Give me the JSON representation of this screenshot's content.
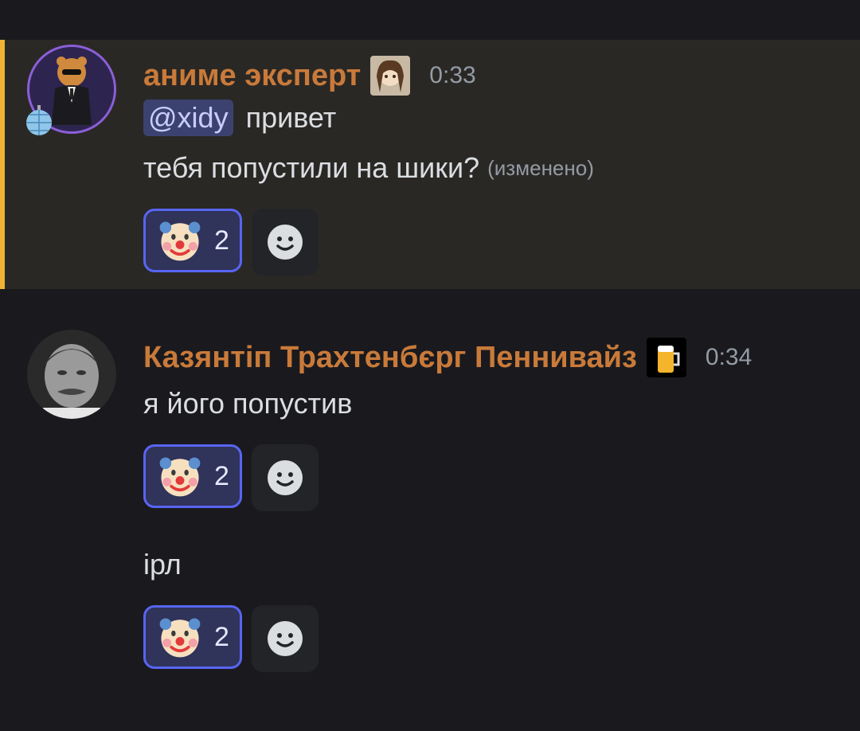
{
  "messages": [
    {
      "author": "аниме эксперт",
      "author_color": "#c97a3a",
      "timestamp": "0:33",
      "lines": [
        {
          "mention": "@xidy",
          "text": "привет"
        },
        {
          "text": "тебя попустили на шики?",
          "edited_label": "(изменено)"
        }
      ],
      "reactions": [
        {
          "emoji": "clown-face",
          "count": "2"
        }
      ]
    },
    {
      "author": "Казянтiп Трахтенбєрг Пеннивайз",
      "author_color": "#c97a3a",
      "timestamp": "0:34",
      "lines": [
        {
          "text": "я його попустив"
        }
      ],
      "reactions": [
        {
          "emoji": "clown-face",
          "count": "2"
        }
      ]
    },
    {
      "lines": [
        {
          "text": "iрл"
        }
      ],
      "reactions": [
        {
          "emoji": "clown-face",
          "count": "2"
        }
      ]
    }
  ],
  "colors": {
    "accent": "#5865f2",
    "highlight_bar": "#f0b232",
    "background": "#1a1a1e"
  }
}
